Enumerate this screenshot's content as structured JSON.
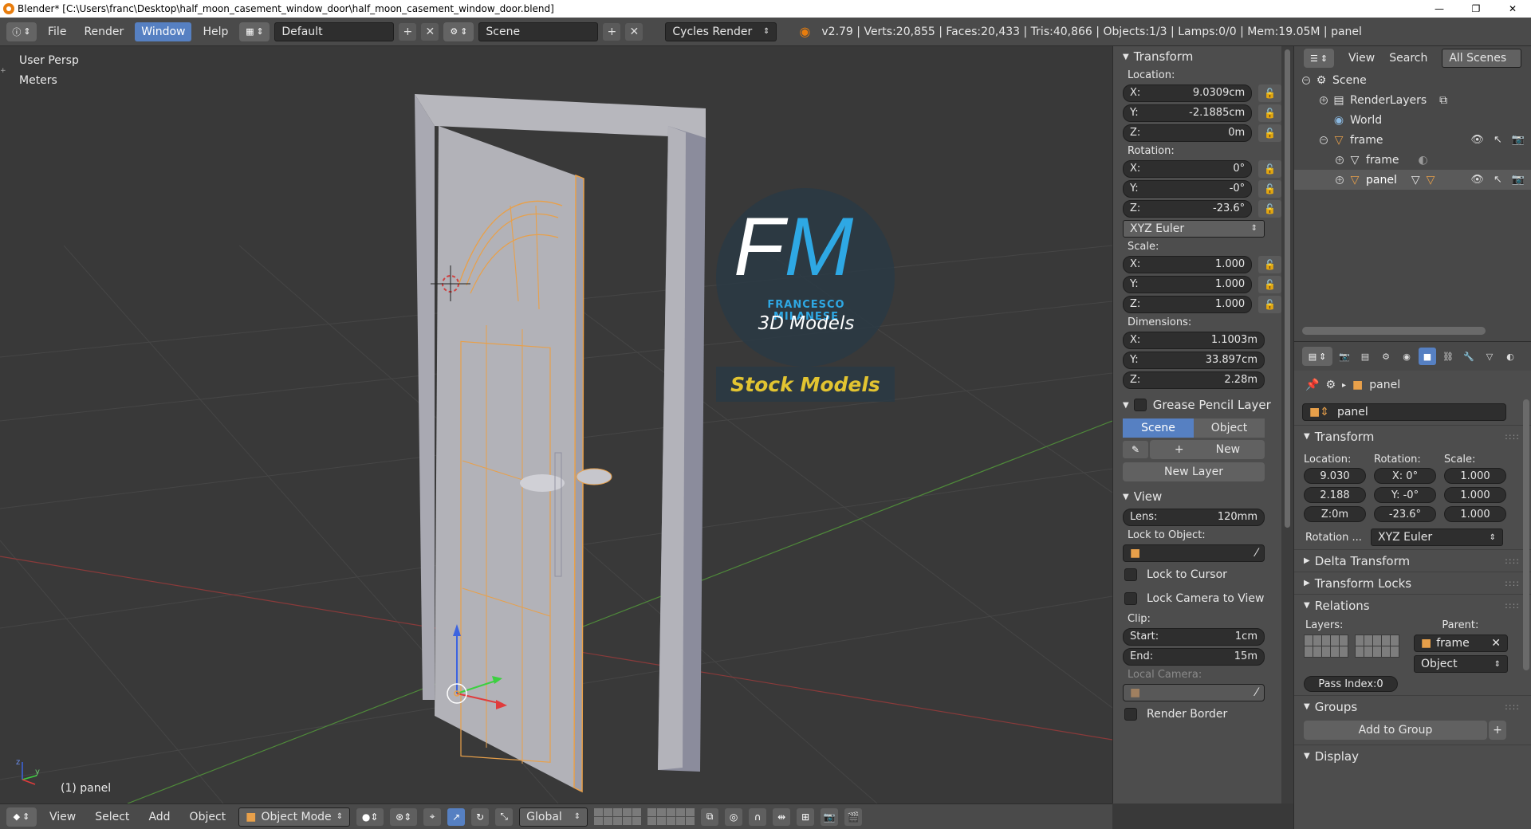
{
  "window": {
    "title": "Blender* [C:\\Users\\franc\\Desktop\\half_moon_casement_window_door\\half_moon_casement_window_door.blend]",
    "minimize": "—",
    "maximize": "❐",
    "close": "✕"
  },
  "topbar": {
    "menus": [
      "File",
      "Render",
      "Window",
      "Help"
    ],
    "active_menu": "Window",
    "layout": "Default",
    "scene": "Scene",
    "render_engine": "Cycles Render",
    "stats": "v2.79 | Verts:20,855 | Faces:20,433 | Tris:40,866 | Objects:1/3 | Lamps:0/0 | Mem:19.05M | panel"
  },
  "viewport": {
    "view_name": "User Persp",
    "units": "Meters",
    "object_label": "(1) panel",
    "watermark_initials": "FM",
    "watermark_author": "FRANCESCO MILANESE",
    "watermark_sub": "3D Models",
    "watermark_banner": "Stock Models",
    "axis_z": "z",
    "axis_y": "y",
    "colors": {
      "background": "#393939",
      "grid": "#4a4a4a",
      "x_axis": "#8a3a3a",
      "y_axis": "#4f8a3a",
      "selection": "#e8a04a"
    }
  },
  "vpfooter": {
    "menus": [
      "View",
      "Select",
      "Add",
      "Object"
    ],
    "mode": "Object Mode",
    "orientation": "Global"
  },
  "npanel": {
    "transform_title": "Transform",
    "location_label": "Location:",
    "location": [
      {
        "ax": "X:",
        "val": "9.0309cm"
      },
      {
        "ax": "Y:",
        "val": "-2.1885cm"
      },
      {
        "ax": "Z:",
        "val": "0m"
      }
    ],
    "rotation_label": "Rotation:",
    "rotation": [
      {
        "ax": "X:",
        "val": "0°"
      },
      {
        "ax": "Y:",
        "val": "-0°"
      },
      {
        "ax": "Z:",
        "val": "-23.6°"
      }
    ],
    "rotation_mode": "XYZ Euler",
    "scale_label": "Scale:",
    "scale": [
      {
        "ax": "X:",
        "val": "1.000"
      },
      {
        "ax": "Y:",
        "val": "1.000"
      },
      {
        "ax": "Z:",
        "val": "1.000"
      }
    ],
    "dimensions_label": "Dimensions:",
    "dimensions": [
      {
        "ax": "X:",
        "val": "1.1003m"
      },
      {
        "ax": "Y:",
        "val": "33.897cm"
      },
      {
        "ax": "Z:",
        "val": "2.28m"
      }
    ],
    "grease_title": "Grease Pencil Layer",
    "grease_scene": "Scene",
    "grease_object": "Object",
    "grease_new": "New",
    "grease_new_layer": "New Layer",
    "view_title": "View",
    "lens_label": "Lens:",
    "lens_value": "120mm",
    "lock_to_object": "Lock to Object:",
    "lock_to_cursor": "Lock to Cursor",
    "lock_camera": "Lock Camera to View",
    "clip_label": "Clip:",
    "clip_start_label": "Start:",
    "clip_start": "1cm",
    "clip_end_label": "End:",
    "clip_end": "15m",
    "local_camera": "Local Camera:",
    "render_border": "Render Border"
  },
  "outliner": {
    "menus": [
      "View",
      "Search"
    ],
    "filter": "All Scenes",
    "items": [
      {
        "name": "Scene",
        "level": 0
      },
      {
        "name": "RenderLayers",
        "level": 1
      },
      {
        "name": "World",
        "level": 1
      },
      {
        "name": "frame",
        "level": 1
      },
      {
        "name": "frame",
        "level": 2
      },
      {
        "name": "panel",
        "level": 2
      }
    ]
  },
  "props": {
    "breadcrumb_object": "panel",
    "object_name": "panel",
    "transform_title": "Transform",
    "location_label": "Location:",
    "rotation_label": "Rotation:",
    "scale_label": "Scale:",
    "location": [
      "9.030",
      "2.188",
      "Z:0m"
    ],
    "rotation": [
      "X:  0°",
      "Y: -0°",
      "-23.6°"
    ],
    "scale": [
      "1.000",
      "1.000",
      "1.000"
    ],
    "rotation_mode_label": "Rotation ...",
    "rotation_mode": "XYZ Euler",
    "delta_title": "Delta Transform",
    "locks_title": "Transform Locks",
    "relations_title": "Relations",
    "layers_label": "Layers:",
    "parent_label": "Parent:",
    "parent": "frame",
    "parent_type": "Object",
    "pass_index": "Pass Index:0",
    "groups_title": "Groups",
    "add_to_group": "Add to Group",
    "display_title": "Display"
  }
}
